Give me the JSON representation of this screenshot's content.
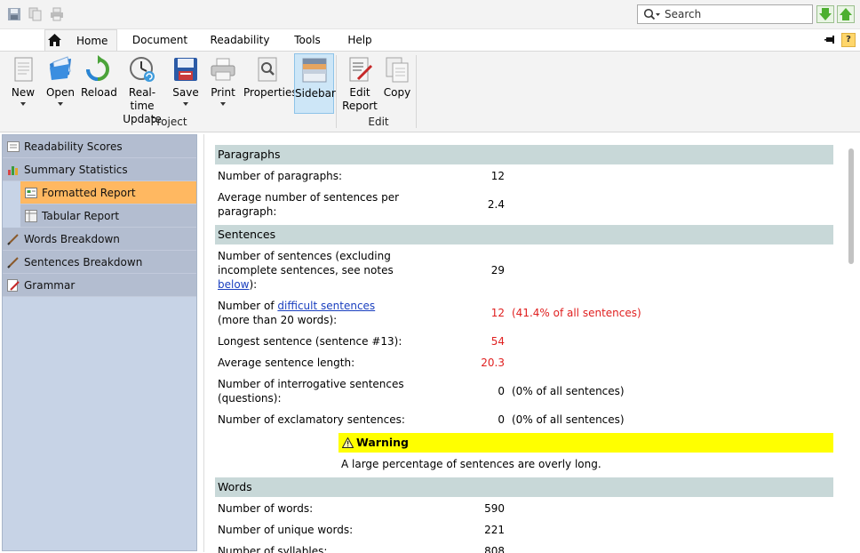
{
  "search": {
    "placeholder": "Search"
  },
  "tabs": [
    {
      "label": "Home",
      "active": true
    },
    {
      "label": "Document"
    },
    {
      "label": "Readability"
    },
    {
      "label": "Tools"
    },
    {
      "label": "Help"
    }
  ],
  "help_label": "?",
  "ribbon": {
    "buttons": [
      {
        "id": "new",
        "label": "New"
      },
      {
        "id": "open",
        "label": "Open"
      },
      {
        "id": "reload",
        "label": "Reload"
      },
      {
        "id": "realtime",
        "label1": "Real-time",
        "label2": "Update"
      },
      {
        "id": "save",
        "label": "Save"
      },
      {
        "id": "print",
        "label": "Print"
      },
      {
        "id": "properties",
        "label": "Properties"
      },
      {
        "id": "sidebar",
        "label": "Sidebar",
        "selected": true
      },
      {
        "id": "editreport",
        "label1": "Edit",
        "label2": "Report"
      },
      {
        "id": "copy",
        "label": "Copy"
      }
    ],
    "groups": {
      "project": "Project",
      "edit": "Edit"
    }
  },
  "sidebar": {
    "items": [
      {
        "label": "Readability Scores",
        "icon": "readability-scores-icon"
      },
      {
        "label": "Summary Statistics",
        "icon": "summary-statistics-icon"
      },
      {
        "label": "Formatted Report",
        "icon": "formatted-report-icon",
        "selected": true
      },
      {
        "label": "Tabular Report",
        "icon": "tabular-report-icon"
      },
      {
        "label": "Words Breakdown",
        "icon": "pencil-icon"
      },
      {
        "label": "Sentences Breakdown",
        "icon": "pencil-icon"
      },
      {
        "label": "Grammar",
        "icon": "grammar-icon"
      }
    ]
  },
  "report": {
    "paragraphs": {
      "heading": "Paragraphs",
      "num_label": "Number of paragraphs:",
      "num_value": "12",
      "avg_label": "Average number of sentences per paragraph:",
      "avg_value": "2.4"
    },
    "sentences": {
      "heading": "Sentences",
      "num_label_pre": "Number of sentences (excluding incomplete sentences, see notes ",
      "num_label_link": "below",
      "num_label_post": "):",
      "num_value": "29",
      "difficult_pre": "Number of ",
      "difficult_link": "difficult sentences",
      "difficult_post": " (more than 20 words):",
      "difficult_value": "12",
      "difficult_note": "(41.4% of all sentences)",
      "longest_label": "Longest sentence (sentence #13):",
      "longest_value": "54",
      "avg_label": "Average sentence length:",
      "avg_value": "20.3",
      "interrog_label": "Number of interrogative sentences (questions):",
      "interrog_value": "0",
      "interrog_note": "(0% of all sentences)",
      "exclam_label": "Number of exclamatory sentences:",
      "exclam_value": "0",
      "exclam_note": "(0% of all sentences)"
    },
    "warning": {
      "title": "Warning",
      "text": "A large percentage of sentences are overly long."
    },
    "words": {
      "heading": "Words",
      "num_label": "Number of words:",
      "num_value": "590",
      "unique_label": "Number of unique words:",
      "unique_value": "221",
      "syll_label": "Number of syllables:",
      "syll_value": "808"
    }
  },
  "colors": {
    "accent_selected": "#ffb861",
    "section_head": "#c8d8d8",
    "warning": "#ffff00",
    "red": "#e01f1f"
  }
}
